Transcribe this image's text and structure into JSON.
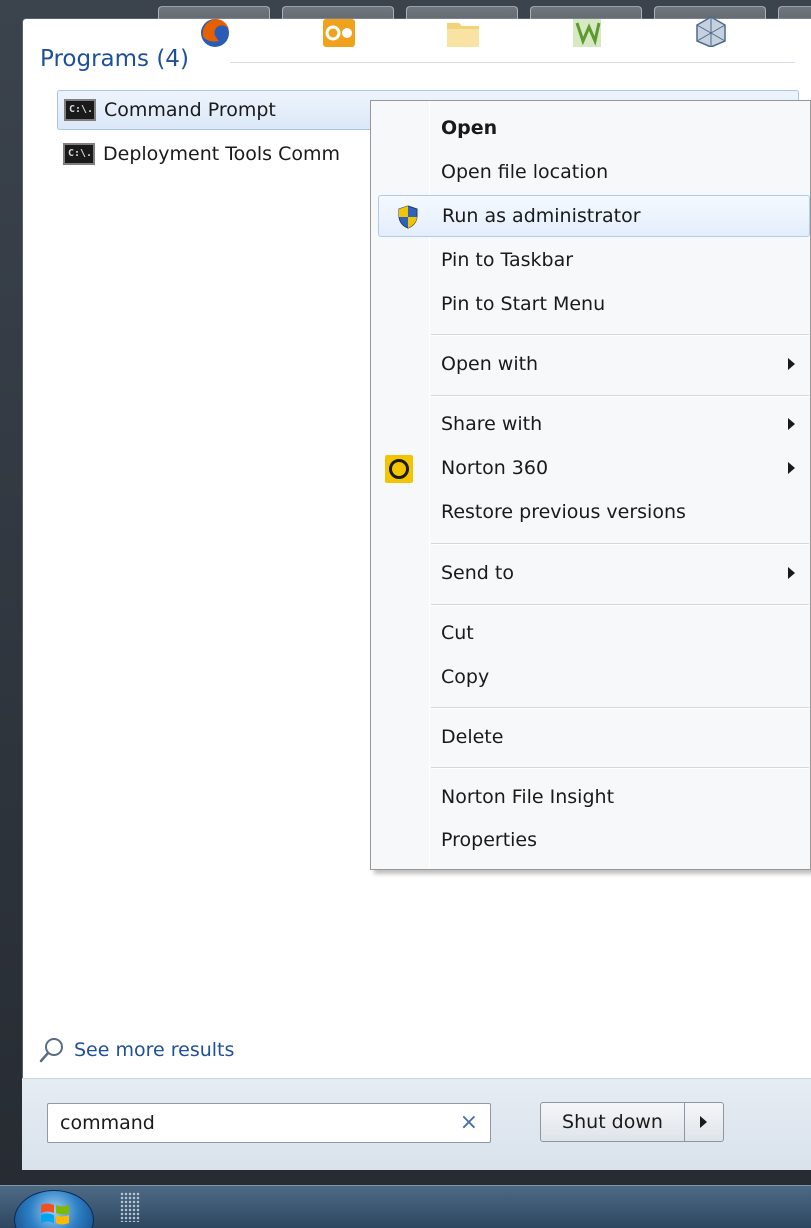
{
  "start_menu": {
    "programs_header": "Programs (4)",
    "results": [
      {
        "label": "Command Prompt",
        "icon": "cmd-icon",
        "icon_text": "C:\\.",
        "selected": true
      },
      {
        "label": "Deployment Tools Comm",
        "icon": "cmd-icon",
        "icon_text": "C:\\.",
        "selected": false
      }
    ],
    "see_more": "See more results",
    "search": {
      "value": "command",
      "clear_glyph": "×"
    },
    "shutdown_label": "Shut down"
  },
  "context_menu": {
    "items": [
      {
        "label": "Open",
        "bold": true
      },
      {
        "label": "Open file location"
      },
      {
        "label": "Run as administrator",
        "icon": "uac-shield-icon",
        "hover": true
      },
      {
        "label": "Pin to Taskbar"
      },
      {
        "label": "Pin to Start Menu"
      },
      {
        "label": "Open with",
        "submenu": true
      },
      {
        "label": "Share with",
        "submenu": true
      },
      {
        "label": "Norton 360",
        "icon": "norton-icon",
        "submenu": true
      },
      {
        "label": "Restore previous versions"
      },
      {
        "label": "Send to",
        "submenu": true
      },
      {
        "label": "Cut"
      },
      {
        "label": "Copy"
      },
      {
        "label": "Delete"
      },
      {
        "label": "Norton File Insight"
      },
      {
        "label": "Properties"
      }
    ]
  },
  "colors": {
    "accent_text": "#1f4f9a",
    "selection_fill": "#dbe8f8",
    "norton_yellow": "#f5c400"
  },
  "taskbar": {
    "items": [
      "start-orb",
      "firefox-icon",
      "outlook-icon",
      "explorer-icon",
      "app-icon",
      "virtualbox-icon"
    ]
  }
}
